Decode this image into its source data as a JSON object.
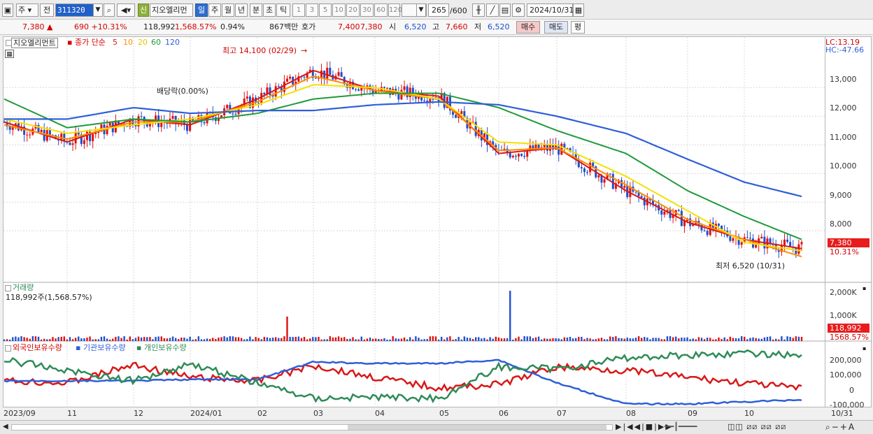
{
  "toolbar": {
    "period_sel": "주",
    "prev_label": "전",
    "code": "311320",
    "credit_badge": "신",
    "stock_name": "지오엘리먼",
    "periods": [
      "일",
      "주",
      "월",
      "년",
      "분",
      "초",
      "틱"
    ],
    "active_period": "일",
    "intervals": [
      "1",
      "3",
      "5",
      "10",
      "20",
      "30",
      "60",
      "120"
    ],
    "count_value": "265",
    "count_total": "/600",
    "date_value": "2024/10/31"
  },
  "quote": {
    "price": "7,380 ▲",
    "change": "690 +10.31%",
    "volume": "118,992",
    "volume_ratio": "1,568.57%",
    "turnover_rate": "0.94%",
    "amount": "867백만",
    "ask_label": "호가",
    "ask_value": "7,400",
    "bid_value": "7,380",
    "open_label": "시",
    "open_value": "6,520",
    "high_label": "고",
    "high_value": "7,660",
    "low_label": "저",
    "low_value": "6,520",
    "sell_label": "매수",
    "buy_label": "매도",
    "avg_label": "평"
  },
  "price_panel": {
    "stock_name": "지오엘리먼트",
    "ma_title": "종가 단순",
    "ma_periods": [
      "5",
      "10",
      "20",
      "60",
      "120"
    ],
    "ma_colors": [
      "#d81818",
      "#ff8c00",
      "#f5e000",
      "#1f9a3a",
      "#2f5fd8"
    ],
    "lc_label": "LC:13.19",
    "hc_label": "HC:-47.66",
    "high_note": "최고 14,100 (02/29)",
    "low_note": "최저 6,520 (10/31)",
    "dividend_note": "배당락(0.00%)",
    "price_tag": "7,380",
    "pct_tag": "10.31%",
    "y_ticks": [
      "13,000",
      "12,000",
      "11,000",
      "10,000",
      "9,000",
      "8,000"
    ]
  },
  "volume_panel": {
    "title": "거래량",
    "value_text": "118,992주(1,568.57%)",
    "y_ticks": [
      "2,000K",
      "1,000K"
    ],
    "vol_tag": "118,992",
    "vol_pct_tag": "1568.57%"
  },
  "holding_panel": {
    "series": [
      "외국인보유수량",
      "기관보유수량",
      "개인보유수량"
    ],
    "colors": [
      "#d81818",
      "#2f5fd8",
      "#2e8b57"
    ],
    "y_ticks": [
      "200,000",
      "100,000",
      "0",
      "-100,000"
    ]
  },
  "x_axis": {
    "labels": [
      "2023/09",
      "11",
      "12",
      "2024/01",
      "02",
      "03",
      "04",
      "05",
      "06",
      "07",
      "08",
      "09",
      "10",
      "10/31"
    ]
  },
  "chart_data": {
    "type": "line",
    "title": "지오엘리먼트 종가 단순",
    "x": [
      "2023/09",
      "11",
      "12",
      "2024/01",
      "02",
      "03",
      "04",
      "05",
      "06",
      "07",
      "08",
      "09",
      "10",
      "10/31"
    ],
    "series": [
      {
        "name": "5",
        "values": [
          11800,
          11100,
          11900,
          11700,
          12600,
          13600,
          12900,
          12700,
          10700,
          10900,
          9400,
          8300,
          7700,
          7380
        ]
      },
      {
        "name": "10",
        "values": [
          11700,
          11200,
          11800,
          11800,
          12500,
          13400,
          12900,
          12600,
          10800,
          10900,
          9600,
          8400,
          7700,
          7100
        ]
      },
      {
        "name": "20",
        "values": [
          11900,
          11400,
          11700,
          11900,
          12400,
          13100,
          13000,
          12600,
          11100,
          11000,
          9900,
          8700,
          7600,
          7300
        ]
      },
      {
        "name": "60",
        "values": [
          12600,
          11600,
          11900,
          11800,
          12100,
          12600,
          12800,
          12800,
          12300,
          11500,
          10700,
          9400,
          8500,
          7700
        ]
      },
      {
        "name": "120",
        "values": [
          11900,
          11900,
          12300,
          12100,
          12200,
          12200,
          12400,
          12500,
          12400,
          12000,
          11400,
          10500,
          9700,
          9200
        ]
      }
    ],
    "ylim": [
      6300,
      14300
    ]
  }
}
